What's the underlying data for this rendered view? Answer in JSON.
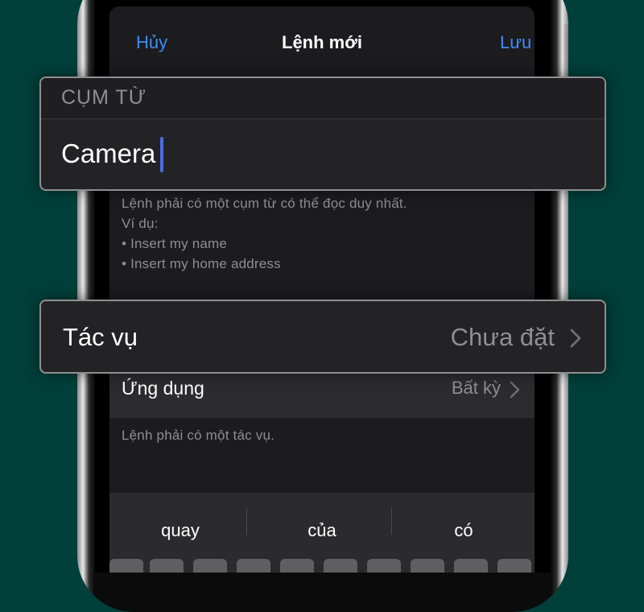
{
  "nav": {
    "cancel": "Hủy",
    "title": "Lệnh mới",
    "save": "Lưu"
  },
  "phrase": {
    "header": "CỤM TỪ",
    "value": "Camera",
    "hint_lines": [
      "Lệnh phải có một cụm từ có thể đọc duy nhất.",
      "Ví dụ:",
      "• Insert my name",
      "• Insert my home address"
    ]
  },
  "action": {
    "label": "Tác vụ",
    "value": "Chưa đặt"
  },
  "app": {
    "label": "Ứng dụng",
    "value": "Bất kỳ",
    "footnote": "Lệnh phải có một tác vụ."
  },
  "keyboard": {
    "suggestions": [
      "quay",
      "của",
      "có"
    ]
  },
  "colors": {
    "background": "#013f3a",
    "accent": "#3d8ef7",
    "cursor": "#4d6be0",
    "secondary_text": "#8e8e93"
  }
}
